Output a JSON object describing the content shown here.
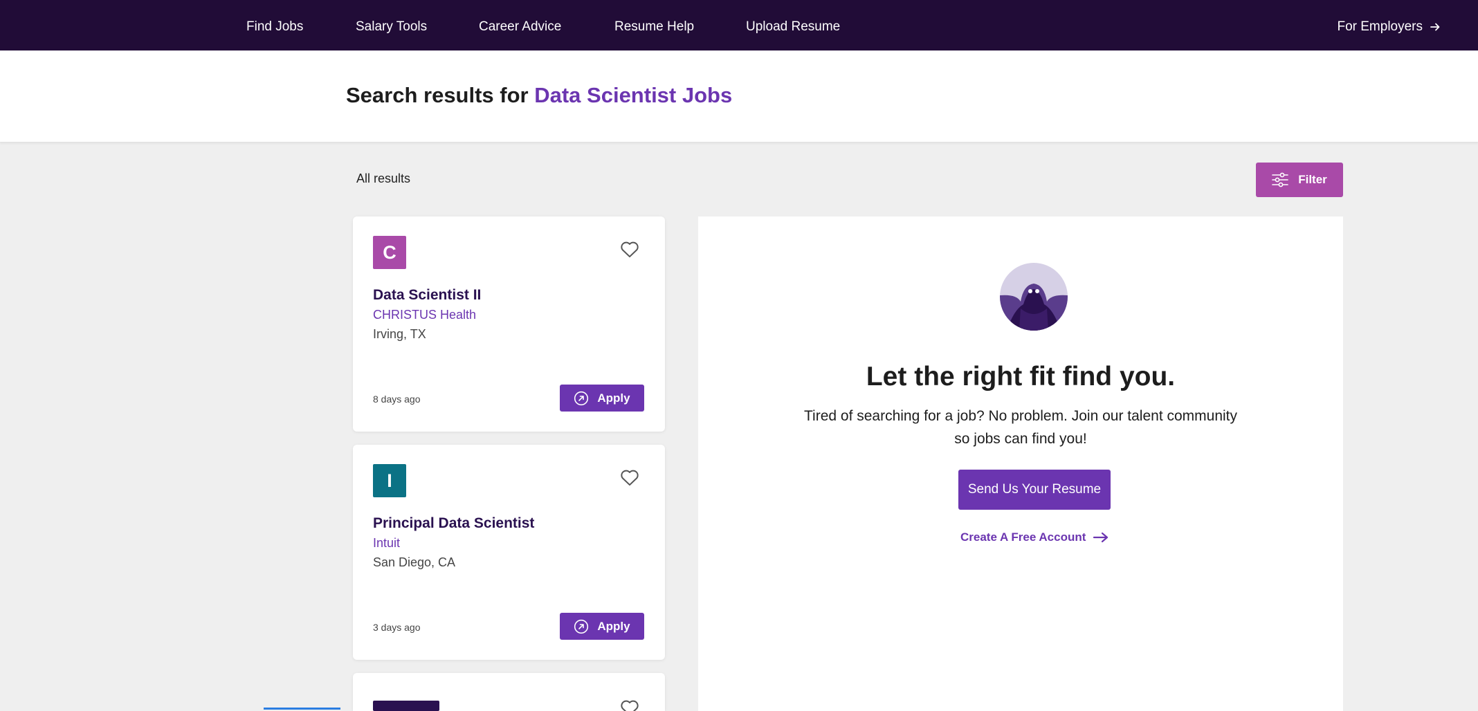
{
  "nav": {
    "links": [
      "Find Jobs",
      "Salary Tools",
      "Career Advice",
      "Resume Help",
      "Upload Resume"
    ],
    "employers": "For Employers"
  },
  "search": {
    "prefix": "Search results for",
    "query": "Data Scientist Jobs"
  },
  "results": {
    "label": "All results",
    "filter_label": "Filter"
  },
  "jobs": [
    {
      "logo_letter": "C",
      "logo_color": "#a94aa8",
      "title": "Data Scientist II",
      "company": "CHRISTUS Health",
      "location": "Irving, TX",
      "posted": "8 days ago",
      "apply_label": "Apply"
    },
    {
      "logo_letter": "I",
      "logo_color": "#0b7285",
      "title": "Principal Data Scientist",
      "company": "Intuit",
      "location": "San Diego, CA",
      "posted": "3 days ago",
      "apply_label": "Apply"
    }
  ],
  "panel": {
    "heading": "Let the right fit find you.",
    "text": "Tired of searching for a job? No problem. Join our talent community so jobs can find you!",
    "button": "Send Us Your Resume",
    "link": "Create A Free Account"
  },
  "colors": {
    "nav_bg": "#210c37",
    "accent": "#6b35b0",
    "filter": "#a94aa8"
  }
}
